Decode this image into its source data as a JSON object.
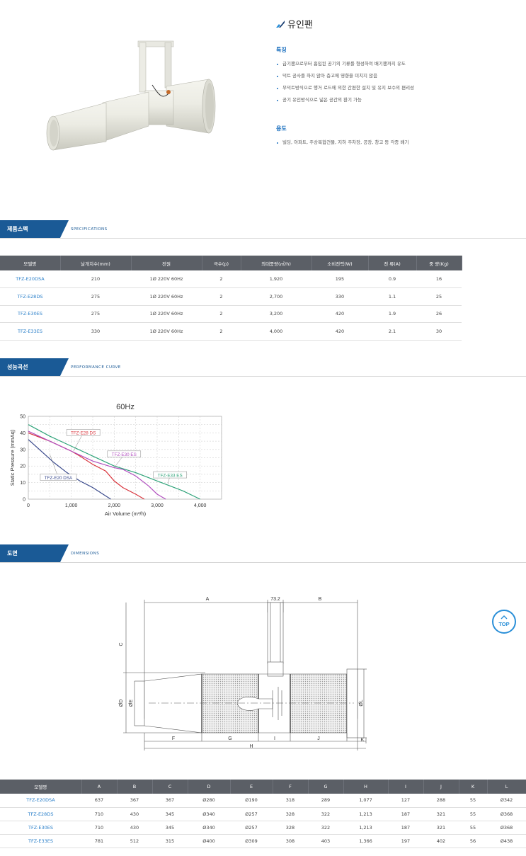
{
  "product": {
    "title": "유인팬",
    "features_heading": "특징",
    "features": [
      "급기팬으로부터 흡입된 공기의 기류를 형성하여 배기팬까지 유도",
      "덕트 공사를 하지 않아 층고에 영향을 미치지 않음",
      "무덕트방식으로 행거 로드에 의한 간편한 설치 및 유지 보수의 편리성",
      "공기 유인방식으로 넓은 공간의 환기 가능"
    ],
    "usage_heading": "용도",
    "usage": [
      "빌딩, 아파트, 주상복합건물, 지하 주차장, 공장, 창고 등 각종 배기"
    ]
  },
  "sections": {
    "spec": {
      "ko": "제품스펙",
      "en": "SPECIFICATIONS"
    },
    "curve": {
      "ko": "성능곡선",
      "en": "PERFORMANCE CURVE"
    },
    "dims": {
      "ko": "도면",
      "en": "DIMENSIONS"
    }
  },
  "spec_table": {
    "headers": [
      "모델명",
      "날개치수(mm)",
      "전원",
      "극수(p)",
      "최대풍량(㎥/h)",
      "소비전력(W)",
      "전 류(A)",
      "중 량(Kg)"
    ],
    "rows": [
      [
        "TFZ-E20DSA",
        "210",
        "1Ø 220V 60Hz",
        "2",
        "1,920",
        "195",
        "0.9",
        "16"
      ],
      [
        "TFZ-E28DS",
        "275",
        "1Ø 220V 60Hz",
        "2",
        "2,700",
        "330",
        "1.1",
        "25"
      ],
      [
        "TFZ-E30ES",
        "275",
        "1Ø 220V 60Hz",
        "2",
        "3,200",
        "420",
        "1.9",
        "26"
      ],
      [
        "TFZ-E33ES",
        "330",
        "1Ø 220V 60Hz",
        "2",
        "4,000",
        "420",
        "2.1",
        "30"
      ]
    ]
  },
  "chart_data": {
    "type": "line",
    "title": "60Hz",
    "xlabel": "Air Volume (m³/h)",
    "ylabel": "Static Pressure (mmAq)",
    "xlim": [
      0,
      4500
    ],
    "ylim": [
      0,
      50
    ],
    "xticks": [
      "0",
      "1,000",
      "2,000",
      "3,000",
      "4,000"
    ],
    "yticks": [
      "0",
      "10",
      "20",
      "30",
      "40",
      "50"
    ],
    "grid": true,
    "series": [
      {
        "name": "TFZ-E20 DSA",
        "color": "#3a4a8c",
        "x": [
          0,
          300,
          600,
          900,
          1200,
          1500,
          1800,
          1920
        ],
        "y": [
          36,
          29,
          22,
          16,
          11,
          7,
          2,
          0
        ]
      },
      {
        "name": "TFZ-E28 DS",
        "color": "#d9343c",
        "x": [
          0,
          500,
          1000,
          1200,
          1500,
          1800,
          2000,
          2200,
          2500,
          2700
        ],
        "y": [
          40,
          35,
          29,
          26,
          21,
          17,
          11,
          7,
          3,
          0
        ]
      },
      {
        "name": "TFZ-E30 ES",
        "color": "#b14fbf",
        "x": [
          0,
          500,
          1000,
          1500,
          2000,
          2200,
          2500,
          2800,
          3000,
          3200
        ],
        "y": [
          41,
          35,
          29,
          23,
          19,
          18,
          14,
          8,
          3,
          0
        ]
      },
      {
        "name": "TFZ-E33 ES",
        "color": "#2fa37a",
        "x": [
          0,
          500,
          1000,
          1500,
          2000,
          2500,
          3000,
          3300,
          3600,
          4000
        ],
        "y": [
          45,
          38,
          32,
          26,
          20,
          16,
          11,
          8,
          5,
          0
        ]
      }
    ]
  },
  "drawing": {
    "labels": {
      "A": "A",
      "B": "B",
      "top": "73.2",
      "C": "C",
      "D": "ØD",
      "E": "ØE",
      "L": "ØL",
      "F": "F",
      "G": "G",
      "I": "I",
      "J": "J",
      "K": "K",
      "H": "H"
    }
  },
  "dims_table": {
    "headers": [
      "모델명",
      "A",
      "B",
      "C",
      "D",
      "E",
      "F",
      "G",
      "H",
      "I",
      "J",
      "K",
      "L"
    ],
    "rows": [
      [
        "TFZ-E20DSA",
        "637",
        "367",
        "367",
        "Ø280",
        "Ø190",
        "318",
        "289",
        "1,077",
        "127",
        "288",
        "55",
        "Ø342"
      ],
      [
        "TFZ-E28DS",
        "710",
        "430",
        "345",
        "Ø340",
        "Ø257",
        "328",
        "322",
        "1,213",
        "187",
        "321",
        "55",
        "Ø368"
      ],
      [
        "TFZ-E30ES",
        "710",
        "430",
        "345",
        "Ø340",
        "Ø257",
        "328",
        "322",
        "1,213",
        "187",
        "321",
        "55",
        "Ø368"
      ],
      [
        "TFZ-E33ES",
        "781",
        "512",
        "315",
        "Ø400",
        "Ø309",
        "308",
        "403",
        "1,366",
        "197",
        "402",
        "56",
        "Ø438"
      ]
    ]
  },
  "top_button": {
    "label": "TOP"
  },
  "colors": {
    "accent": "#1a5a96",
    "link": "#2a7fc9",
    "header": "#5b5f66"
  }
}
